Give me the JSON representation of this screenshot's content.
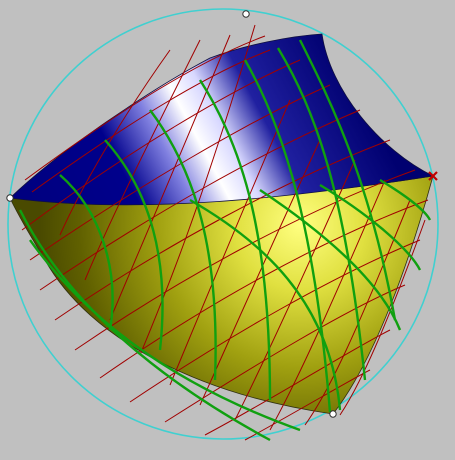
{
  "viewport": {
    "background_color": "#c0c0c0"
  },
  "colors": {
    "boundary_circle": "#40d0d0",
    "top_surface_dark": "#000080",
    "top_surface_light": "#ffffff",
    "bottom_surface_dark": "#606000",
    "bottom_surface_light": "#ffff80",
    "grid_red": "#a00000",
    "grid_green": "#10a010",
    "control_point_fill": "#ffffff",
    "control_point_stroke": "#303030",
    "marker_red": "#c00000"
  },
  "icons": {
    "control_point": "circle-handle-icon",
    "corner_marker": "x-marker-icon"
  }
}
